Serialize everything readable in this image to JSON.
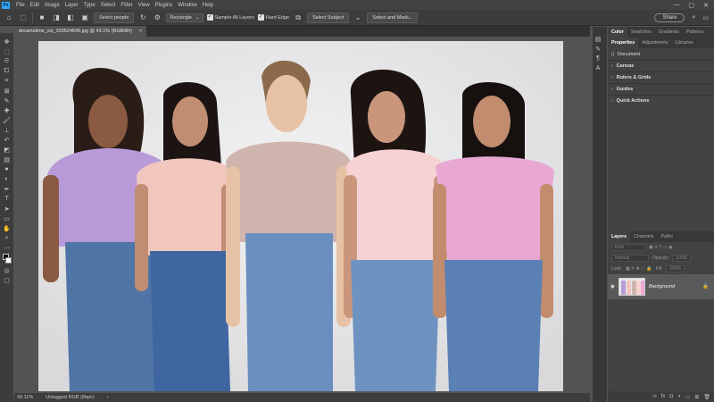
{
  "menu": {
    "logo": "Ps",
    "items": [
      "File",
      "Edit",
      "Image",
      "Layer",
      "Type",
      "Select",
      "Filter",
      "View",
      "Plugins",
      "Window",
      "Help"
    ],
    "window_controls": [
      "—",
      "▢",
      "✕"
    ]
  },
  "options": {
    "select_people": "Select people",
    "mode": "Rectangle",
    "sample_all_layers": "Sample All Layers",
    "hard_edge": "Hard Edge",
    "select_subject": "Select Subject",
    "select_and_mask": "Select and Mask...",
    "share": "Share"
  },
  "document": {
    "tab_title": "dreamstime_xxl_203524649.jpg @ 43.1% (RGB/8#)",
    "close": "×"
  },
  "status": {
    "zoom": "43.11%",
    "profile": "Untagged RGB (8bpc)",
    "arrow": "›"
  },
  "panels": {
    "top_tabs": [
      "Color",
      "Swatches",
      "Gradients",
      "Patterns"
    ],
    "prop_tabs": [
      "Properties",
      "Adjustments",
      "Libraries"
    ],
    "document_label": "Document",
    "sections": [
      "Canvas",
      "Rulers & Grids",
      "Guides",
      "Quick Actions"
    ],
    "layer_tabs": [
      "Layers",
      "Channels",
      "Paths"
    ],
    "kind": "Kind",
    "blend": "Normal",
    "opacity_label": "Opacity:",
    "opacity": "100%",
    "lock_label": "Lock:",
    "fill_label": "Fill:",
    "fill": "100%",
    "layer_name": "Background"
  },
  "colors": {
    "accent": "#31a8ff",
    "shirts": [
      "#b89ad8",
      "#f0c6bd",
      "#cfb5ad",
      "#f6d3d2",
      "#e9a8d4"
    ],
    "jeans": "#4f74a6"
  },
  "icons": [
    "move-icon",
    "marquee-icon",
    "lasso-icon",
    "object-select-icon",
    "crop-icon",
    "frame-icon",
    "eyedropper-icon",
    "healing-icon",
    "brush-icon",
    "stamp-icon",
    "history-brush-icon",
    "eraser-icon",
    "gradient-icon",
    "blur-icon",
    "dodge-icon",
    "pen-icon",
    "type-icon",
    "path-select-icon",
    "shape-icon",
    "hand-icon",
    "zoom-icon",
    "more-icon"
  ]
}
